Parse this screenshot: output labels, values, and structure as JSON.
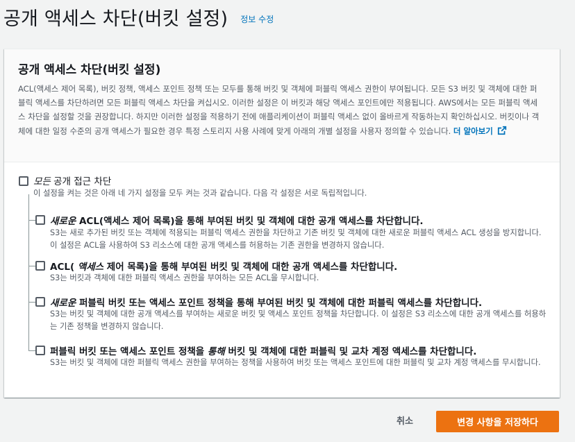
{
  "page": {
    "title": "공개 액세스 차단(버킷 설정)",
    "info_link": "정보 수정"
  },
  "panel": {
    "title": "공개 액세스 차단(버킷 설정)",
    "description": "ACL(액세스 제어 목록), 버킷 정책, 액세스 포인트 정책 또는 모두를 통해 버킷 및 객체에 퍼블릭 액세스 권한이 부여됩니다. 모든 S3 버킷 및 객체에 대한 퍼블릭 액세스를 차단하려면 모든 퍼블릭 액세스 차단을 켜십시오. 이러한 설정은 이 버킷과 해당 액세스 포인트에만 적용됩니다. AWS에서는 모든 퍼블릭 액세스 차단을 설정할 것을 권장합니다. 하지만 이러한 설정을 적용하기 전에 애플리케이션이 퍼블릭 액세스 없이 올바르게 작동하는지 확인하십시오. 버킷이나 객체에 대한 일정 수준의 공개 액세스가 필요한 경우 특정 스토리지 사용 사례에 맞게 아래의 개별 설정을 사용자 정의할 수 있습니다.",
    "learn_more": "더 알아보기",
    "icons": {
      "external": "external-link-icon"
    }
  },
  "options": {
    "all": {
      "label_italic": "모든",
      "label_rest": " 공개 접근 차단",
      "desc": "이 설정을 켜는 것은 아래 네 가지 설정을 모두 켜는 것과 같습니다. 다음 각 설정은 서로 독립적입니다.",
      "checked": false
    },
    "items": [
      {
        "label_pre": "",
        "label_italic": "새로운",
        "label_rest": " ACL(액세스 제어 목록)을 통해 부여된 버킷 및 객체에 대한 공개 액세스를 차단합니다.",
        "desc": "S3는 새로 추가된 버킷 또는 객체에 적용되는 퍼블릭 액세스 권한을 차단하고 기존 버킷 및 객체에 대한 새로운 퍼블릭 액세스 ACL 생성을 방지합니다. 이 설정은 ACL을 사용하여 S3 리소스에 대한 공개 액세스를 허용하는 기존 권한을 변경하지 않습니다.",
        "checked": false
      },
      {
        "label_pre": "ACL( ",
        "label_italic": "액세스",
        "label_rest": " 제어 목록)을 통해 부여된 버킷 및 객체에 대한 공개 액세스를 차단합니다.",
        "desc": "S3는 버킷과 객체에 대한 퍼블릭 액세스 권한을 부여하는 모든 ACL을 무시합니다.",
        "checked": false
      },
      {
        "label_pre": "",
        "label_italic": "새로운",
        "label_rest": " 퍼블릭 버킷 또는 액세스 포인트 정책을 통해 부여된 버킷 및 객체에 대한 퍼블릭 액세스를 차단합니다.",
        "desc": "S3는 버킷 및 객체에 대한 공개 액세스를 부여하는 새로운 버킷 및 액세스 포인트 정책을 차단합니다. 이 설정은 S3 리소스에 대한 공개 액세스를 허용하는 기존 정책을 변경하지 않습니다.",
        "checked": false
      },
      {
        "label_pre": "퍼블릭 버킷 또는 액세스 포인트 정책을 ",
        "label_italic": "통해",
        "label_rest": " 버킷 및 객체에 대한 퍼블릭 및 교차 계정 액세스를 차단합니다.",
        "desc": "S3는 버킷 및 객체에 대한 퍼블릭 액세스 권한을 부여하는 정책을 사용하여 버킷 또는 액세스 포인트에 대한 퍼블릭 및 교차 계정 액세스를 무시합니다.",
        "checked": false
      }
    ]
  },
  "footer": {
    "cancel_label": "취소",
    "save_label": "변경 사항을 저장하다"
  },
  "colors": {
    "primary": "#ec7211",
    "link": "#0073bb",
    "text": "#16191f",
    "muted": "#545b64"
  }
}
